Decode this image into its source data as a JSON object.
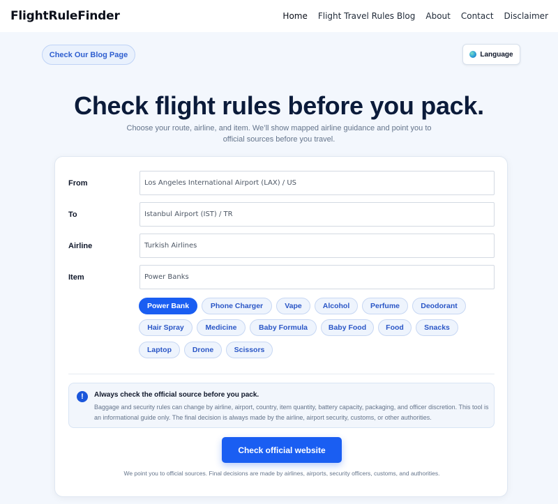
{
  "nav": {
    "brand": "FlightRuleFinder",
    "links": [
      "Home",
      "Flight Travel Rules Blog",
      "About",
      "Contact",
      "Disclaimer"
    ]
  },
  "blog_button": "Check Our Blog Page",
  "language_button": {
    "label": "Language",
    "icon": "globe-icon"
  },
  "hero": {
    "title": "Check flight rules before you pack.",
    "subtitle": "Choose your route, airline, and item. We’ll show mapped airline guidance and point you to official sources before you travel."
  },
  "form": {
    "from": {
      "label": "From",
      "value": "Los Angeles International Airport (LAX) / US"
    },
    "to": {
      "label": "To",
      "value": "Istanbul Airport (IST) / TR"
    },
    "airline": {
      "label": "Airline",
      "value": "Turkish Airlines"
    },
    "item": {
      "label": "Item",
      "value": "Power Banks"
    }
  },
  "chips": [
    {
      "label": "Power Bank",
      "active": true
    },
    {
      "label": "Phone Charger"
    },
    {
      "label": "Vape"
    },
    {
      "label": "Alcohol"
    },
    {
      "label": "Perfume"
    },
    {
      "label": "Deodorant"
    },
    {
      "label": "Hair Spray"
    },
    {
      "label": "Medicine"
    },
    {
      "label": "Baby Formula"
    },
    {
      "label": "Baby Food"
    },
    {
      "label": "Food"
    },
    {
      "label": "Snacks"
    },
    {
      "label": "Laptop"
    },
    {
      "label": "Drone"
    },
    {
      "label": "Scissors"
    }
  ],
  "notice": {
    "icon": "!",
    "title": "Always check the official source before you pack.",
    "body": "Baggage and security rules can change by airline, airport, country, item quantity, battery capacity, packaging, and officer discretion. This tool is an informational guide only. The final decision is always made by the airline, airport security, customs, or other authorities."
  },
  "cta_label": "Check official website",
  "footnote": "We point you to official sources. Final decisions are made by airlines, airports, security officers, customs, and authorities.",
  "colors": {
    "accent": "#1a5ef2",
    "background": "#f3f7fd",
    "title": "#0b1b3a"
  }
}
